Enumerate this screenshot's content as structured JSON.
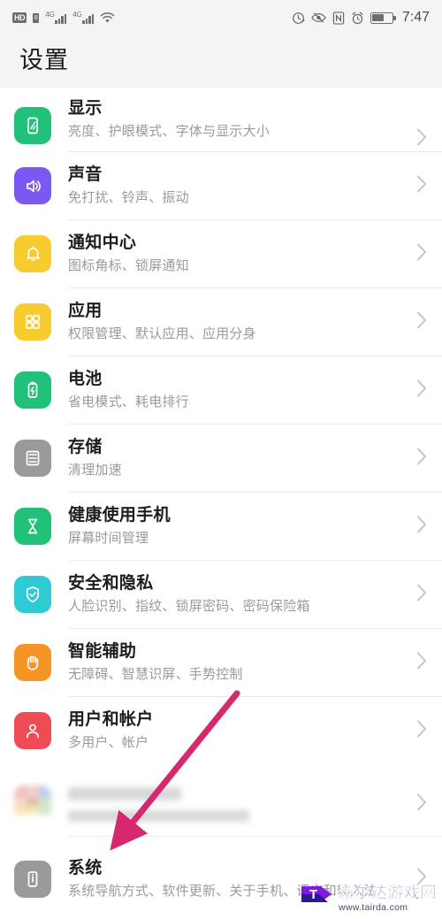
{
  "status_bar": {
    "hd_label": "HD",
    "sim_label": "8",
    "network_1": "4G",
    "network_2": "4G",
    "icons": [
      "hd-icon",
      "sim-icon",
      "signal-4g-1-icon",
      "signal-4g-2-icon",
      "wifi-icon",
      "clock-sync-icon",
      "eye-comfort-icon",
      "nfc-icon",
      "alarm-icon",
      "battery-icon"
    ],
    "time": "7:47"
  },
  "header": {
    "title": "设置"
  },
  "groups": [
    {
      "rows": [
        {
          "title": "显示",
          "subtitle": "亮度、护眼模式、字体与显示大小",
          "icon": "display-icon",
          "icon_color": "#21c17a",
          "partial_top": true
        },
        {
          "title": "声音",
          "subtitle": "免打扰、铃声、振动",
          "icon": "sound-icon",
          "icon_color": "#7b58f2"
        },
        {
          "title": "通知中心",
          "subtitle": "图标角标、锁屏通知",
          "icon": "notification-bell-icon",
          "icon_color": "#f8cb2e"
        },
        {
          "title": "应用",
          "subtitle": "权限管理、默认应用、应用分身",
          "icon": "apps-grid-icon",
          "icon_color": "#f8cb2e"
        },
        {
          "title": "电池",
          "subtitle": "省电模式、耗电排行",
          "icon": "battery-icon",
          "icon_color": "#21c17a"
        },
        {
          "title": "存储",
          "subtitle": "清理加速",
          "icon": "storage-icon",
          "icon_color": "#9a9a9a"
        },
        {
          "title": "健康使用手机",
          "subtitle": "屏幕时间管理",
          "icon": "hourglass-icon",
          "icon_color": "#21c17a"
        },
        {
          "title": "安全和隐私",
          "subtitle": "人脸识别、指纹、锁屏密码、密码保险箱",
          "icon": "shield-check-icon",
          "icon_color": "#2ecbd4"
        },
        {
          "title": "智能辅助",
          "subtitle": "无障碍、智慧识屏、手势控制",
          "icon": "hand-icon",
          "icon_color": "#f59528"
        },
        {
          "title": "用户和帐户",
          "subtitle": "多用户、帐户",
          "icon": "user-account-icon",
          "icon_color": "#ee4b55"
        }
      ]
    },
    {
      "rows": [
        {
          "title": "",
          "subtitle": "",
          "icon": "blurred-app-icon",
          "icon_color": "",
          "blurred": true
        },
        {
          "title": "系统",
          "subtitle": "系统导航方式、软件更新、关于手机、语言和输入法",
          "icon": "system-info-icon",
          "icon_color": "#9a9a9a"
        }
      ]
    }
  ],
  "annotation": {
    "arrow_color": "#d6286f",
    "arrow_name": "pink-pointer-arrow",
    "points_to": "系统"
  },
  "watermark": {
    "site_name": "泰尔达游戏网",
    "url": "www.tairda.com",
    "logo_letter": "T"
  }
}
